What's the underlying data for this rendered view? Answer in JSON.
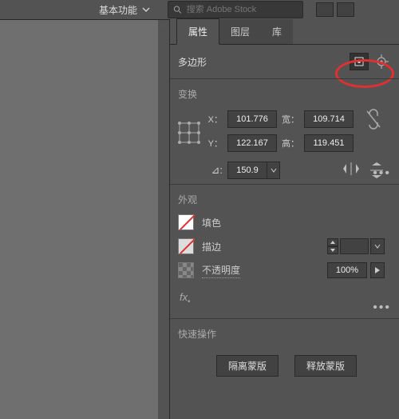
{
  "topbar": {
    "workspace": "基本功能",
    "search_placeholder": "搜索 Adobe Stock"
  },
  "tabs": {
    "t0": "属性",
    "t1": "图层",
    "t2": "库"
  },
  "panel": {
    "shape_title": "多边形",
    "transform": {
      "title": "变换",
      "x_label": "X：",
      "x": "101.776",
      "y_label": "Y：",
      "y": "122.167",
      "w_label": "宽：",
      "w": "109.714",
      "h_label": "高：",
      "h": "119.451",
      "angle_symbol": "⊿:",
      "angle": "150.9"
    },
    "appearance": {
      "title": "外观",
      "fill_label": "填色",
      "stroke_label": "描边",
      "opacity_label": "不透明度",
      "opacity_value": "100%",
      "fx_label": "fx"
    },
    "quick": {
      "title": "快速操作",
      "btn0": "隔离蒙版",
      "btn1": "释放蒙版"
    }
  }
}
